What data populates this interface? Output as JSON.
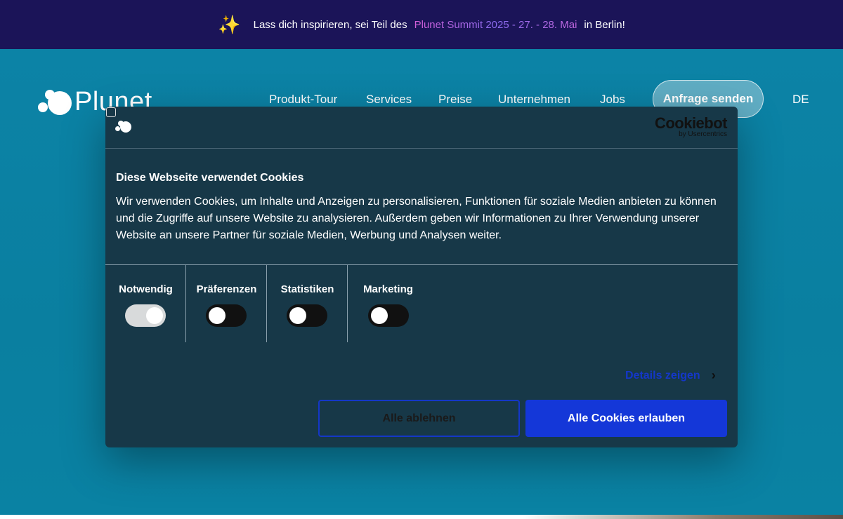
{
  "announcement": {
    "icon": "sparkles-icon",
    "text_before": "Lass dich inspirieren, sei Teil des",
    "highlight": "Plunet Summit 2025 - 27. - 28. Mai",
    "text_after": "in Berlin!"
  },
  "header": {
    "logo_text": "Plunet",
    "nav": [
      "Produkt-Tour",
      "Services",
      "Preise",
      "Unternehmen",
      "Jobs"
    ],
    "cta": "Anfrage senden",
    "language": "DE"
  },
  "cookie_dialog": {
    "provider_name": "Cookiebot",
    "provider_sub": "by Usercentrics",
    "title": "Diese Webseite verwendet Cookies",
    "body": "Wir verwenden Cookies, um Inhalte und Anzeigen zu personalisieren, Funktionen für soziale Medien anbieten zu können und die Zugriffe auf unsere Website zu analysieren. Außerdem geben wir Informationen zu Ihrer Verwendung unserer Website an unsere Partner für soziale Medien, Werbung und Analysen weiter.",
    "categories": [
      {
        "label": "Notwendig",
        "enabled": true
      },
      {
        "label": "Präferenzen",
        "enabled": false
      },
      {
        "label": "Statistiken",
        "enabled": false
      },
      {
        "label": "Marketing",
        "enabled": false
      }
    ],
    "details_link": "Details zeigen",
    "deny_button": "Alle ablehnen",
    "allow_button": "Alle Cookies erlauben"
  },
  "colors": {
    "topbar": "#1b1458",
    "hero": "#0a7fa0",
    "dialog": "#173848",
    "accent_blue": "#1437d8"
  }
}
